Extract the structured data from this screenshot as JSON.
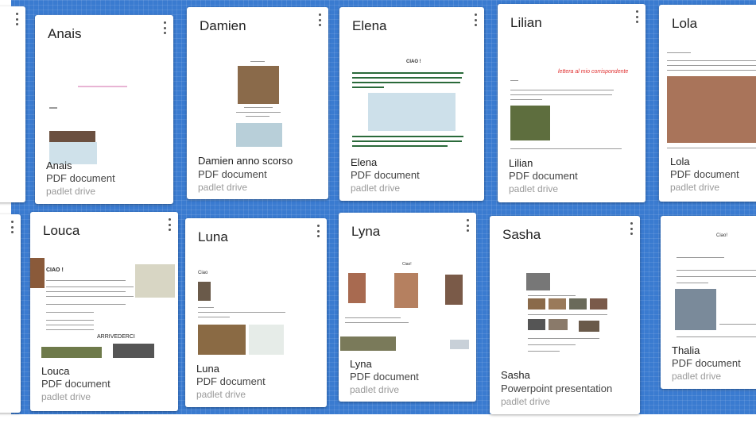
{
  "colors": {
    "board": "#3a7bd0",
    "card": "#ffffff",
    "source_text": "#9a9a9a"
  },
  "menu_icon": "more-vert-icon",
  "cards": [
    {
      "title": "Anais",
      "name": "Anais",
      "type": "PDF document",
      "source": "padlet drive"
    },
    {
      "title": "Damien",
      "name": "Damien anno scorso",
      "type": "PDF document",
      "source": "padlet drive"
    },
    {
      "title": "Elena",
      "name": "Elena",
      "type": "PDF document",
      "source": "padlet drive"
    },
    {
      "title": "Lilian",
      "name": "Lilian",
      "type": "PDF document",
      "source": "padlet drive"
    },
    {
      "title": "Lola",
      "name": "Lola",
      "type": "PDF document",
      "source": "padlet drive"
    },
    {
      "title": "Louca",
      "name": "Louca",
      "type": "PDF document",
      "source": "padlet drive"
    },
    {
      "title": "Luna",
      "name": "Luna",
      "type": "PDF document",
      "source": "padlet drive"
    },
    {
      "title": "Lyna",
      "name": "Lyna",
      "type": "PDF document",
      "source": "padlet drive"
    },
    {
      "title": "Sasha",
      "name": "Sasha",
      "type": "Powerpoint presentation",
      "source": "padlet drive"
    },
    {
      "title": "",
      "name": "Thalia",
      "type": "PDF document",
      "source": "padlet drive"
    }
  ],
  "previews": {
    "elena_heading": "CIAO !",
    "lilian_heading": "lettera al mio corrispondente",
    "louca_heading": "CIAO !",
    "louca_footer": "ARRIVEDERCI",
    "luna_heading": "Ciao",
    "lyna_heading": "Ciao!",
    "thalia_heading": "Ciao!"
  }
}
